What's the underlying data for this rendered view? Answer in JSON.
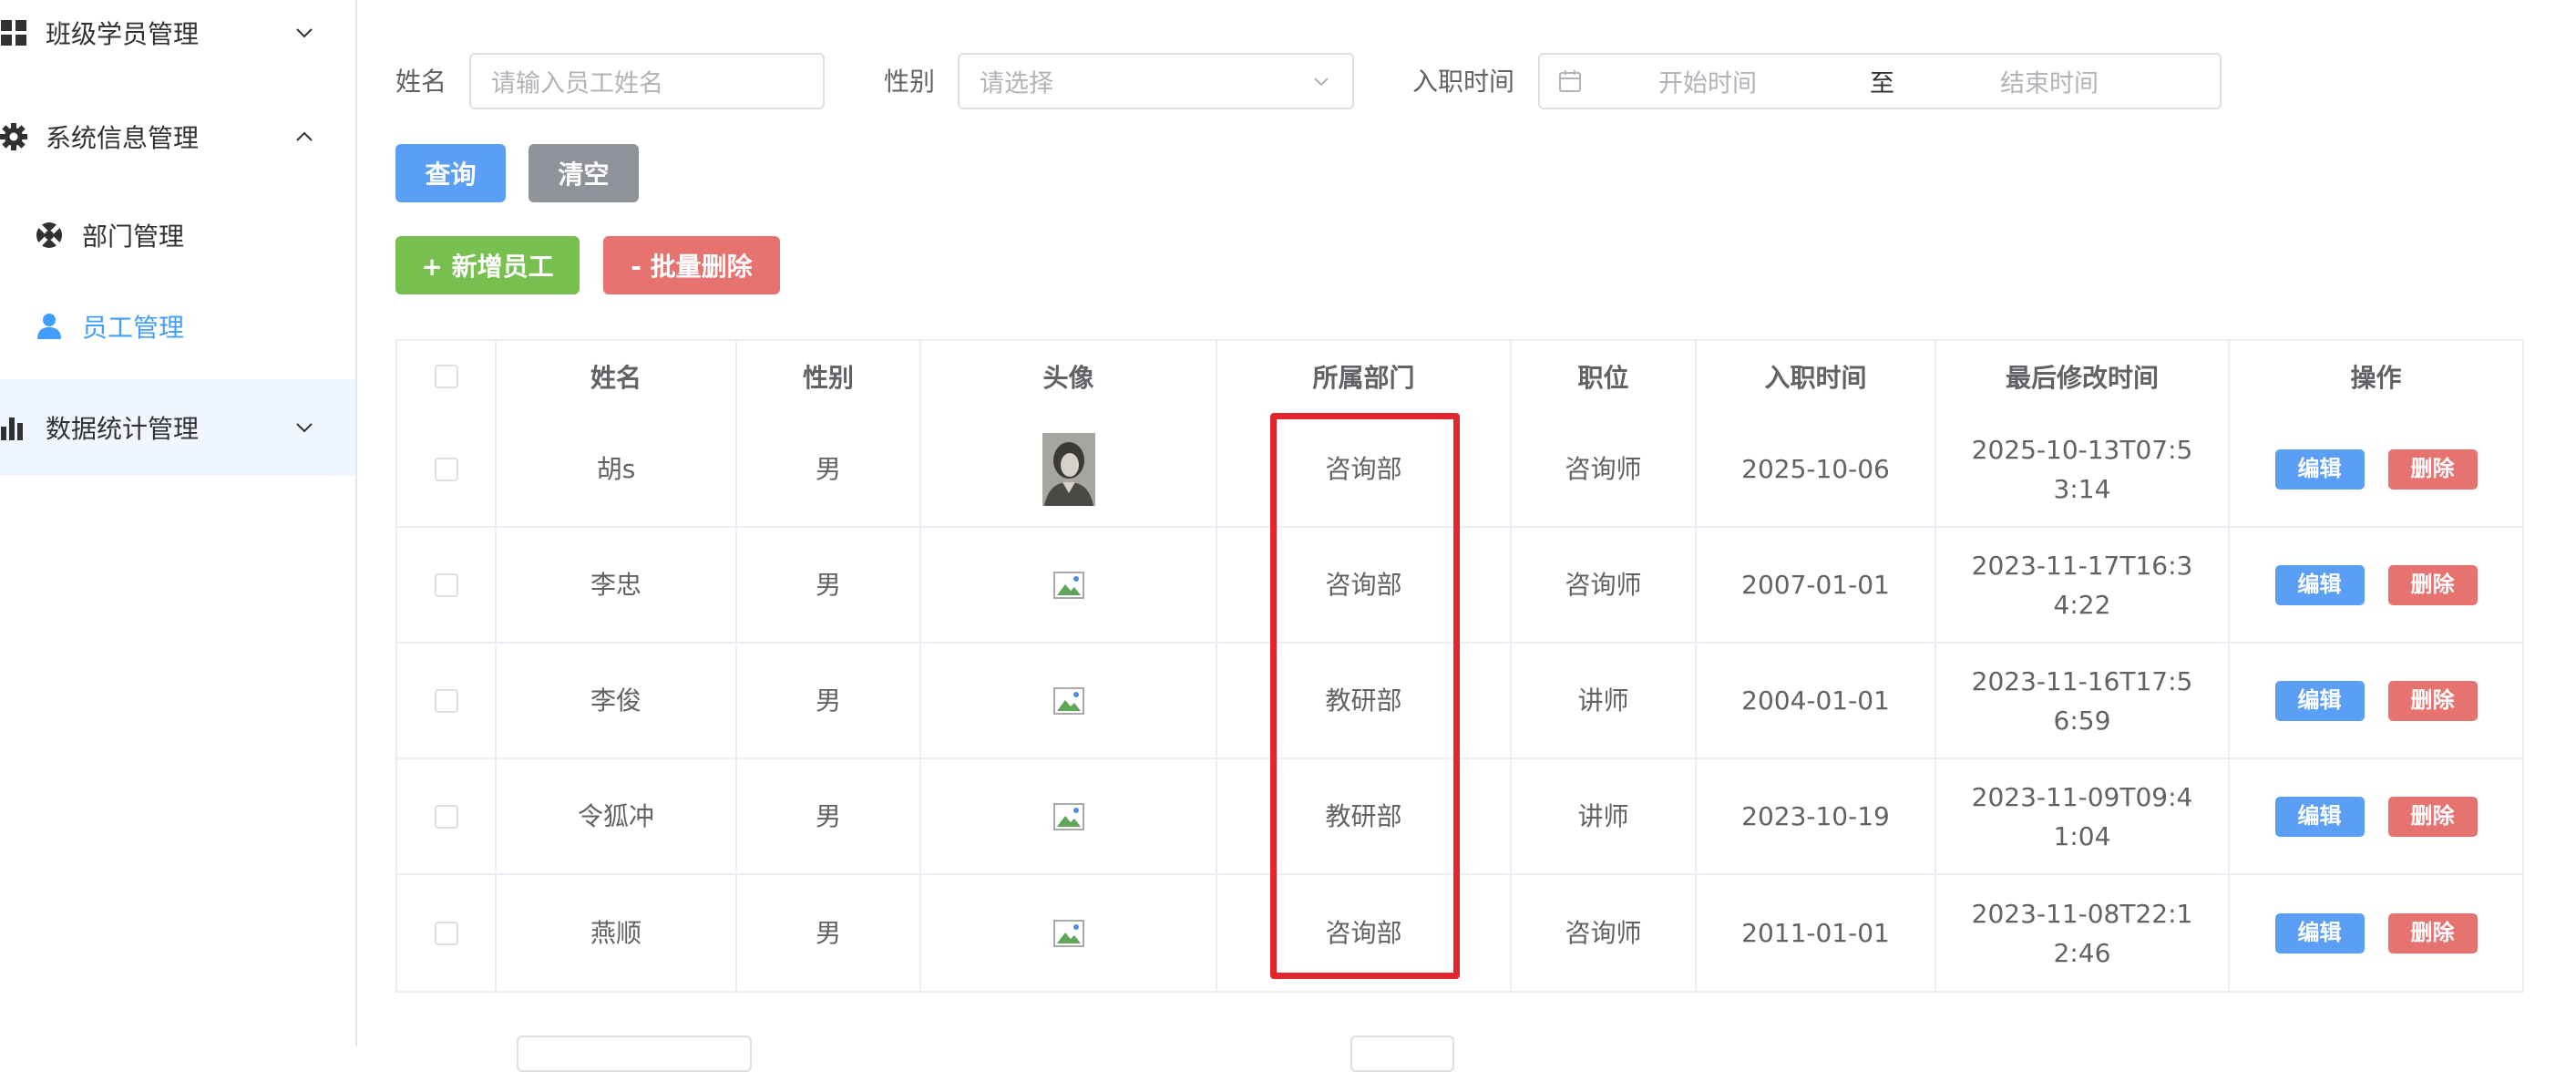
{
  "sidebar": {
    "groups": [
      {
        "label": "班级学员管理",
        "icon": "grid-icon",
        "expanded": false
      },
      {
        "label": "系统信息管理",
        "icon": "gear-icon",
        "expanded": true
      },
      {
        "label": "数据统计管理",
        "icon": "bar-chart-icon",
        "expanded": false
      }
    ],
    "sub_items": [
      {
        "label": "部门管理",
        "icon": "dept-icon"
      },
      {
        "label": "员工管理",
        "icon": "user-icon",
        "selected": true
      }
    ]
  },
  "filters": {
    "name_label": "姓名",
    "name_placeholder": "请输入员工姓名",
    "gender_label": "性别",
    "gender_placeholder": "请选择",
    "date_label": "入职时间",
    "date_start_placeholder": "开始时间",
    "date_separator": "至",
    "date_end_placeholder": "结束时间"
  },
  "buttons": {
    "query": "查询",
    "clear": "清空",
    "add": "+ 新增员工",
    "batch_delete": "- 批量删除"
  },
  "table": {
    "headers": [
      "姓名",
      "性别",
      "头像",
      "所属部门",
      "职位",
      "入职时间",
      "最后修改时间",
      "操作"
    ],
    "rows": [
      {
        "name": "胡s",
        "gender": "男",
        "dept": "咨询部",
        "position": "咨询师",
        "entry": "2025-10-06",
        "modified": "2025-10-13T07:53:14",
        "avatar": "photo"
      },
      {
        "name": "李忠",
        "gender": "男",
        "dept": "咨询部",
        "position": "咨询师",
        "entry": "2007-01-01",
        "modified": "2023-11-17T16:34:22",
        "avatar": "broken"
      },
      {
        "name": "李俊",
        "gender": "男",
        "dept": "教研部",
        "position": "讲师",
        "entry": "2004-01-01",
        "modified": "2023-11-16T17:56:59",
        "avatar": "broken"
      },
      {
        "name": "令狐冲",
        "gender": "男",
        "dept": "教研部",
        "position": "讲师",
        "entry": "2023-10-19",
        "modified": "2023-11-09T09:41:04",
        "avatar": "broken"
      },
      {
        "name": "燕顺",
        "gender": "男",
        "dept": "咨询部",
        "position": "咨询师",
        "entry": "2011-01-01",
        "modified": "2023-11-08T22:12:46",
        "avatar": "broken"
      }
    ],
    "edit_label": "编辑",
    "delete_label": "删除"
  },
  "colors": {
    "primary": "#5b9ef5",
    "info": "#909399",
    "success": "#77bf4f",
    "danger": "#e77370",
    "highlight": "#e3262e"
  }
}
